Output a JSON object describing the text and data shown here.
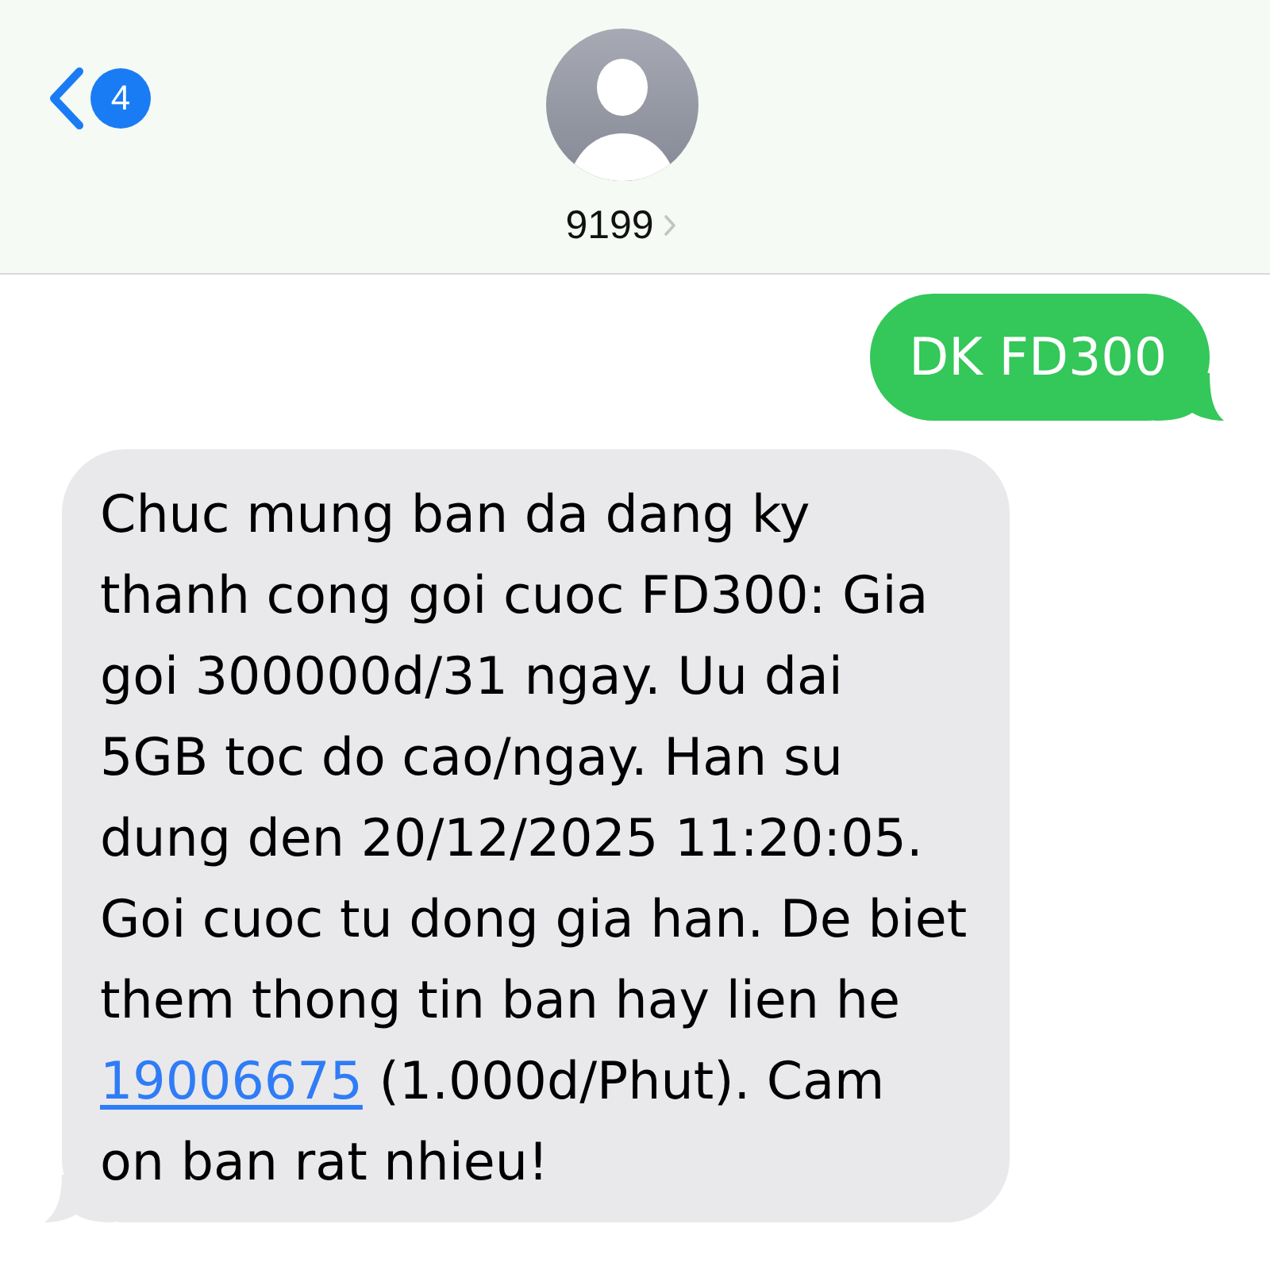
{
  "header": {
    "unread_count": "4",
    "contact_name": "9199"
  },
  "messages": [
    {
      "kind": "sent",
      "segments": [
        {
          "kind": "text",
          "text": "DK FD300"
        }
      ]
    },
    {
      "kind": "received",
      "segments": [
        {
          "kind": "text",
          "text": "Chuc mung ban da dang ky\nthanh cong goi cuoc FD300: Gia\ngoi 300000d/31 ngay. Uu dai\n5GB toc do cao/ngay. Han su\ndung den 20/12/2025 11:20:05.\nGoi cuoc tu dong gia han. De biet\nthem thong tin ban hay lien he\n"
        },
        {
          "kind": "link",
          "text": "19006675"
        },
        {
          "kind": "text",
          "text": " (1.000d/Phut). Cam\non ban rat nhieu!"
        }
      ]
    }
  ]
}
